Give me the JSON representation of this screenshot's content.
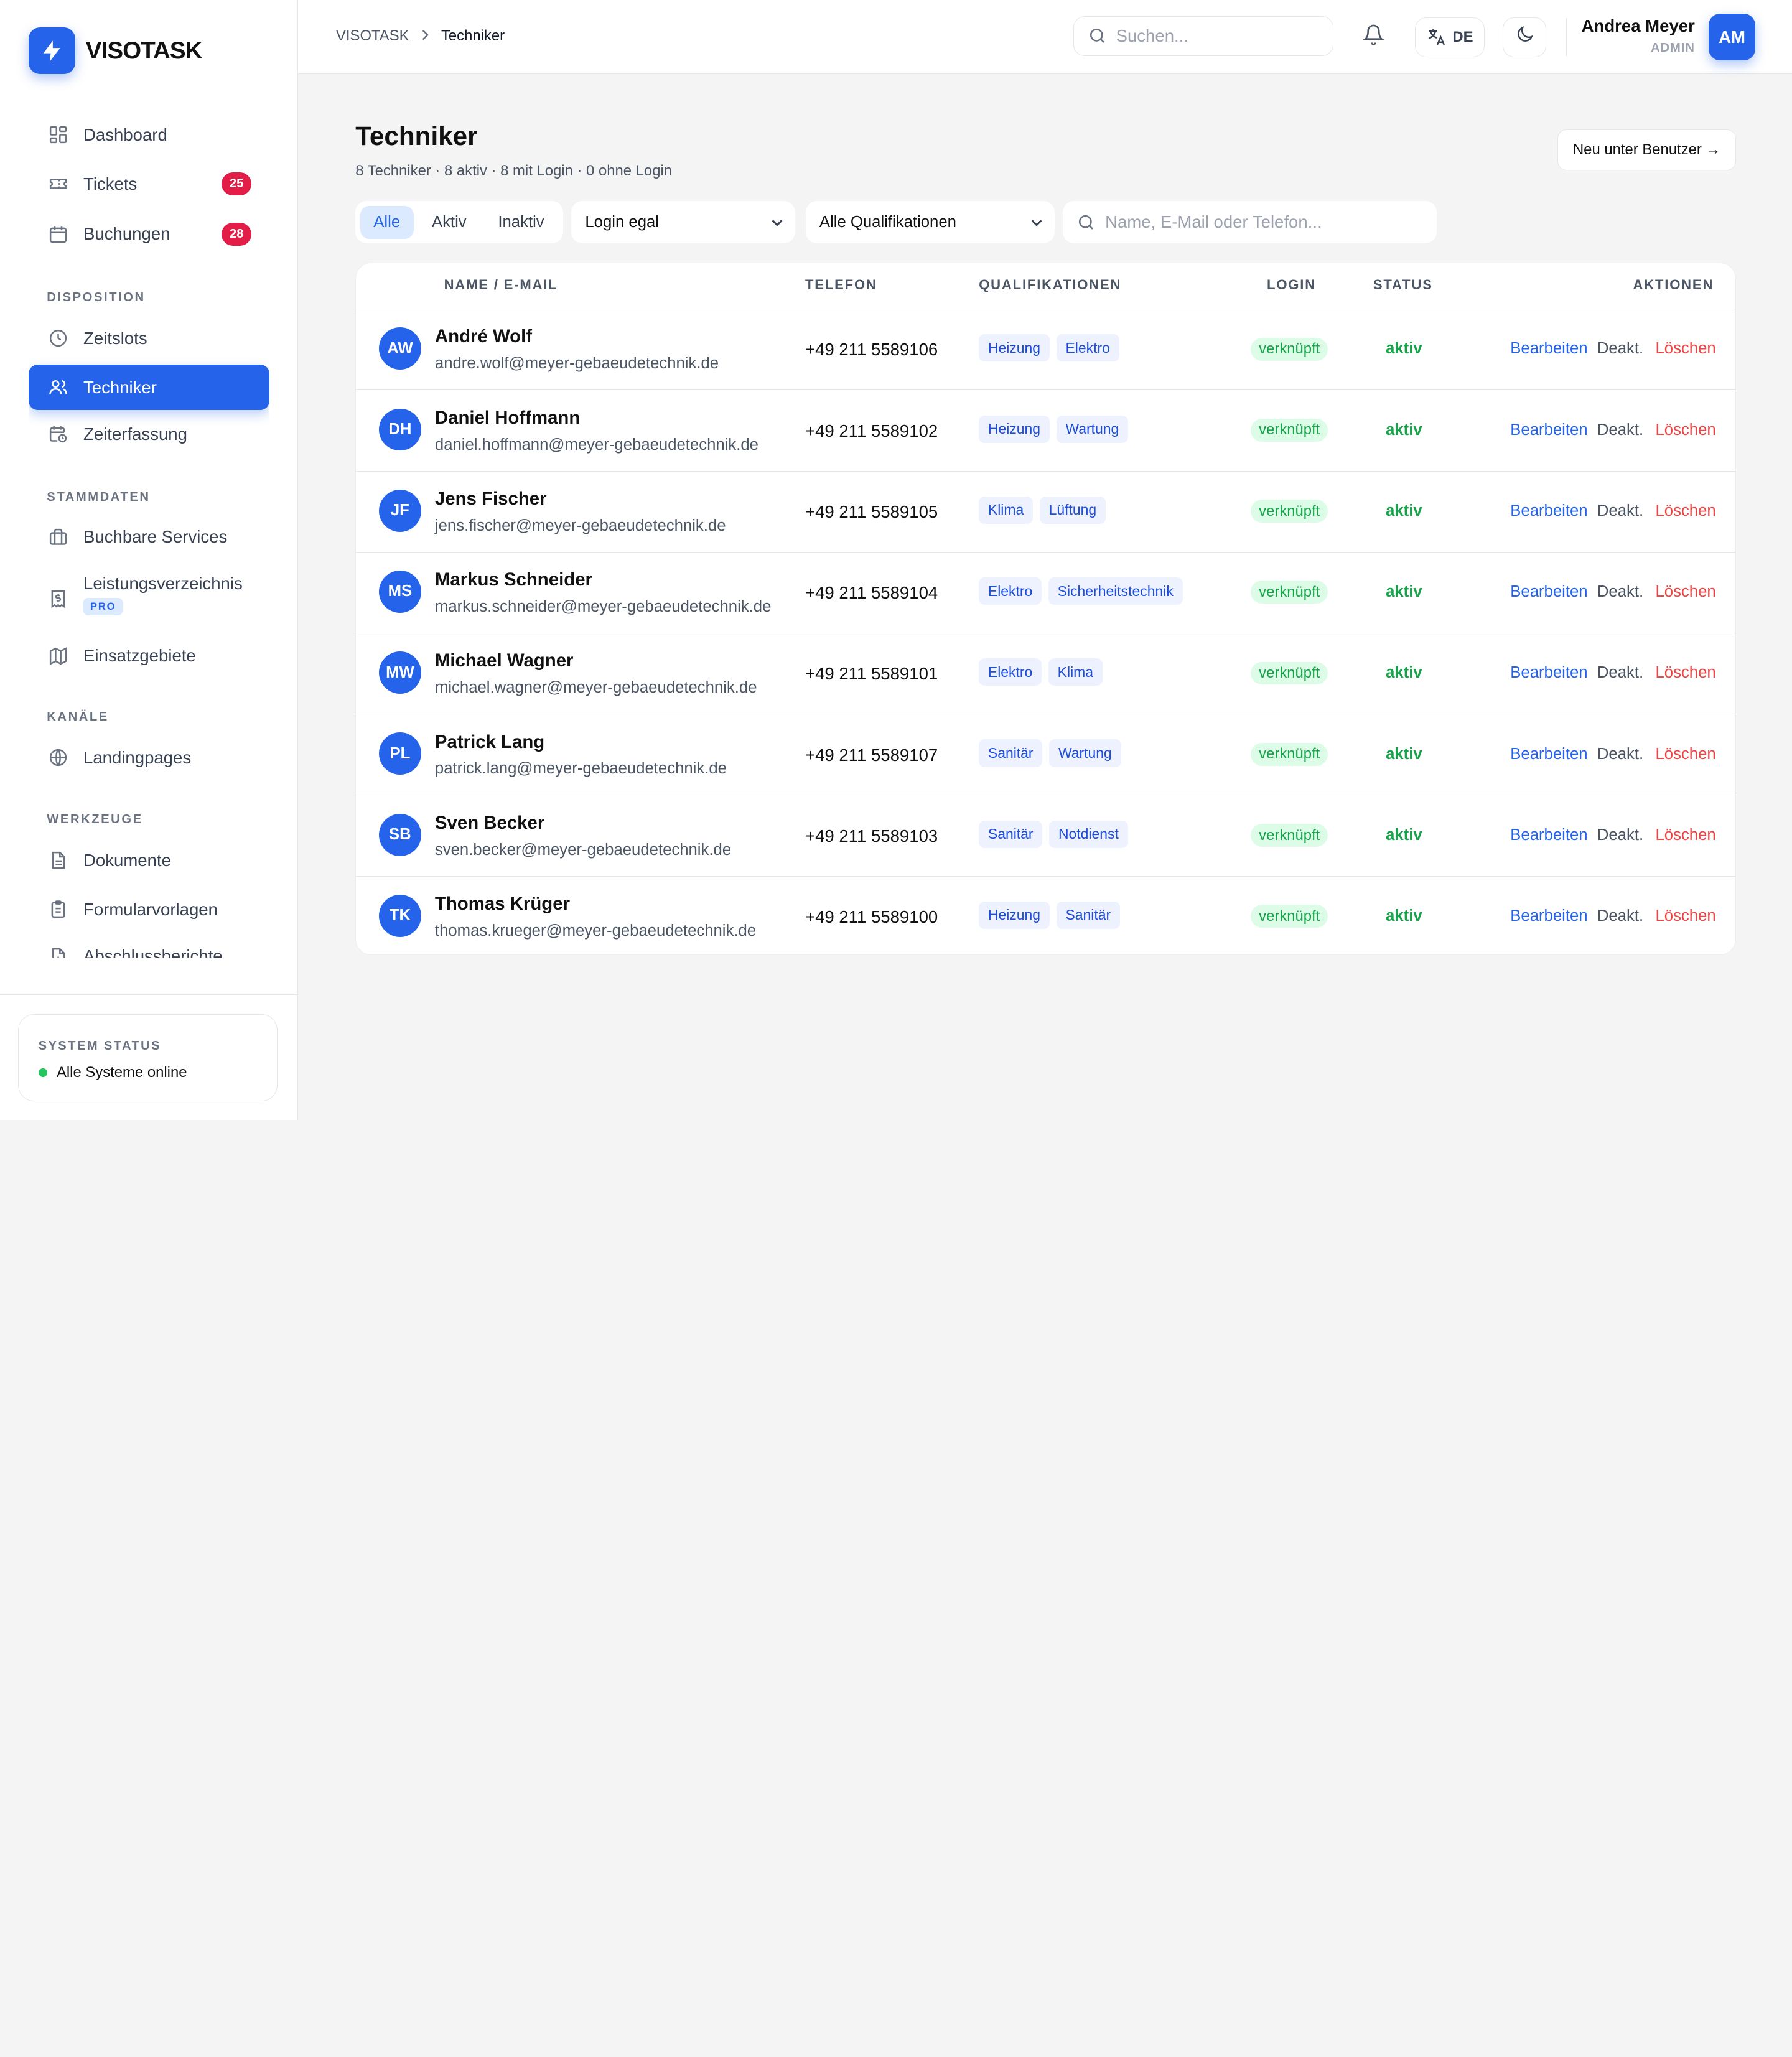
{
  "brand": {
    "name": "VISOTASK"
  },
  "nav": {
    "items": [
      {
        "key": "dashboard",
        "label": "Dashboard",
        "icon": "grid-icon"
      },
      {
        "key": "tickets",
        "label": "Tickets",
        "icon": "ticket-icon",
        "badge": "25"
      },
      {
        "key": "buchungen",
        "label": "Buchungen",
        "icon": "calendar-icon",
        "badge": "28"
      }
    ],
    "section_disposition": "DISPOSITION",
    "disposition": [
      {
        "key": "zeitslots",
        "label": "Zeitslots",
        "icon": "clock-icon"
      },
      {
        "key": "techniker",
        "label": "Techniker",
        "icon": "users-icon",
        "active": true
      },
      {
        "key": "zeiterfassung",
        "label": "Zeiterfassung",
        "icon": "calendar-clock-icon"
      }
    ],
    "section_stammdaten": "STAMMDATEN",
    "stammdaten": [
      {
        "key": "services",
        "label": "Buchbare Services",
        "icon": "briefcase-icon"
      },
      {
        "key": "leistungsverzeichnis",
        "label": "Leistungsverzeichnis",
        "icon": "receipt-icon",
        "badge": "PRO"
      },
      {
        "key": "einsatzgebiete",
        "label": "Einsatzgebiete",
        "icon": "map-icon"
      }
    ],
    "section_kanaele": "KANÄLE",
    "kanaele": [
      {
        "key": "landingpages",
        "label": "Landingpages",
        "icon": "globe-icon"
      }
    ],
    "section_werkzeuge": "WERKZEUGE",
    "werkzeuge": [
      {
        "key": "dokumente",
        "label": "Dokumente",
        "icon": "file-icon"
      },
      {
        "key": "formularvorlagen",
        "label": "Formularvorlagen",
        "icon": "clipboard-icon"
      },
      {
        "key": "abschlussberichte",
        "label": "Abschlussberichte",
        "icon": "file-chart-icon"
      }
    ]
  },
  "system_status": {
    "title": "SYSTEM STATUS",
    "text": "Alle Systeme online",
    "color": "#22c55e"
  },
  "topbar": {
    "breadcrumb_root": "VISOTASK",
    "breadcrumb_current": "Techniker",
    "search_placeholder": "Suchen...",
    "lang": "DE",
    "user_name": "Andrea Meyer",
    "user_role": "ADMIN",
    "user_initials": "AM"
  },
  "page": {
    "title": "Techniker",
    "subtitle": "8 Techniker · 8 aktiv · 8 mit Login · 0 ohne Login",
    "new_button": "Neu unter Benutzer →"
  },
  "filters": {
    "segments": [
      "Alle",
      "Aktiv",
      "Inaktiv"
    ],
    "selected_segment": "Alle",
    "login": "Login egal",
    "qualifikationen": "Alle Qualifikationen",
    "search_placeholder": "Name, E-Mail oder Telefon..."
  },
  "table": {
    "headers": {
      "name": "NAME / E-MAIL",
      "phone": "TELEFON",
      "quals": "QUALIFIKATIONEN",
      "login": "LOGIN",
      "status": "STATUS",
      "actions": "AKTIONEN"
    },
    "action_labels": {
      "edit": "Bearbeiten",
      "deactivate": "Deakt.",
      "delete": "Löschen"
    },
    "rows": [
      {
        "initials": "AW",
        "name": "André Wolf",
        "email": "andre.wolf@meyer-gebaeudetechnik.de",
        "phone": "+49 211 5589106",
        "quals": [
          "Heizung",
          "Elektro"
        ],
        "login": "verknüpft",
        "status": "aktiv"
      },
      {
        "initials": "DH",
        "name": "Daniel Hoffmann",
        "email": "daniel.hoffmann@meyer-gebaeudetechnik.de",
        "phone": "+49 211 5589102",
        "quals": [
          "Heizung",
          "Wartung"
        ],
        "login": "verknüpft",
        "status": "aktiv"
      },
      {
        "initials": "JF",
        "name": "Jens Fischer",
        "email": "jens.fischer@meyer-gebaeudetechnik.de",
        "phone": "+49 211 5589105",
        "quals": [
          "Klima",
          "Lüftung"
        ],
        "login": "verknüpft",
        "status": "aktiv"
      },
      {
        "initials": "MS",
        "name": "Markus Schneider",
        "email": "markus.schneider@meyer-gebaeudetechnik.de",
        "phone": "+49 211 5589104",
        "quals": [
          "Elektro",
          "Sicherheitstechnik"
        ],
        "login": "verknüpft",
        "status": "aktiv"
      },
      {
        "initials": "MW",
        "name": "Michael Wagner",
        "email": "michael.wagner@meyer-gebaeudetechnik.de",
        "phone": "+49 211 5589101",
        "quals": [
          "Elektro",
          "Klima"
        ],
        "login": "verknüpft",
        "status": "aktiv"
      },
      {
        "initials": "PL",
        "name": "Patrick Lang",
        "email": "patrick.lang@meyer-gebaeudetechnik.de",
        "phone": "+49 211 5589107",
        "quals": [
          "Sanitär",
          "Wartung"
        ],
        "login": "verknüpft",
        "status": "aktiv"
      },
      {
        "initials": "SB",
        "name": "Sven Becker",
        "email": "sven.becker@meyer-gebaeudetechnik.de",
        "phone": "+49 211 5589103",
        "quals": [
          "Sanitär",
          "Notdienst"
        ],
        "login": "verknüpft",
        "status": "aktiv"
      },
      {
        "initials": "TK",
        "name": "Thomas Krüger",
        "email": "thomas.krueger@meyer-gebaeudetechnik.de",
        "phone": "+49 211 5589100",
        "quals": [
          "Heizung",
          "Sanitär"
        ],
        "login": "verknüpft",
        "status": "aktiv"
      }
    ]
  },
  "colors": {
    "accent": "#2563eb",
    "badge": "#e11d48",
    "success": "#16a34a",
    "danger": "#ef4444"
  }
}
